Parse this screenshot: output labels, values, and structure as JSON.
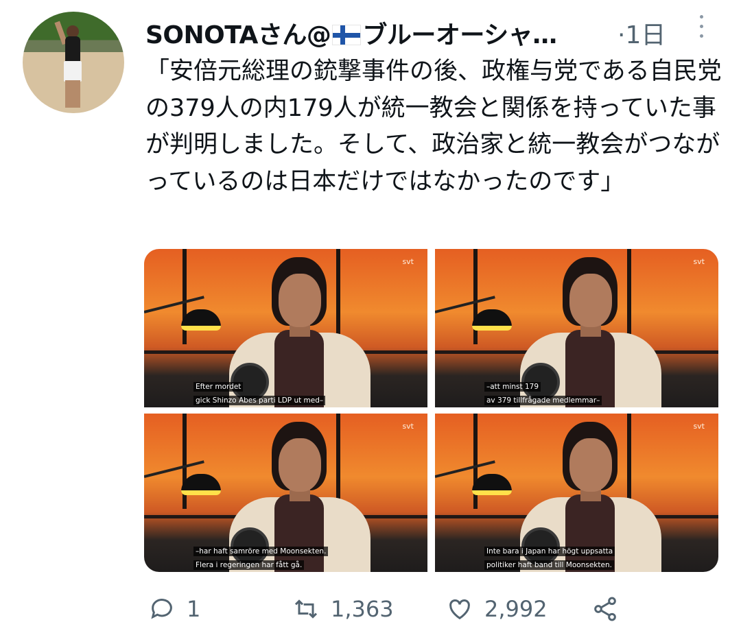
{
  "tweet": {
    "author": "SONOTAさん@",
    "author_suffix": "ブルーオーシャ…",
    "time": "·1日",
    "text": "「安倍元総理の銃撃事件の後、政権与党である自民党の379人の内179人が統一教会と関係を持っていた事が判明しました。そして、政治家と統一教会がつながっているのは日本だけではなかったのです」"
  },
  "media": [
    {
      "logo": "svt",
      "line1": "Efter mordet",
      "line2": "gick Shinzo Abes parti LDP ut med–"
    },
    {
      "logo": "svt",
      "line1": "–att minst 179",
      "line2": "av 379 tillfrågade medlemmar–"
    },
    {
      "logo": "svt",
      "line1": "–har haft samröre med Moonsekten.",
      "line2": "Flera i regeringen har fått gå."
    },
    {
      "logo": "svt",
      "line1": "Inte bara i Japan har högt uppsatta",
      "line2": "politiker haft band till Moonsekten."
    }
  ],
  "actions": {
    "reply_count": "1",
    "retweet_count": "1,363",
    "like_count": "2,992"
  },
  "icons": [
    "reply-icon",
    "retweet-icon",
    "like-icon",
    "share-icon",
    "more-icon",
    "finland-flag-icon"
  ],
  "colors": {
    "text": "#0f1419",
    "muted": "#536471",
    "flag_blue": "#1f55a8"
  }
}
